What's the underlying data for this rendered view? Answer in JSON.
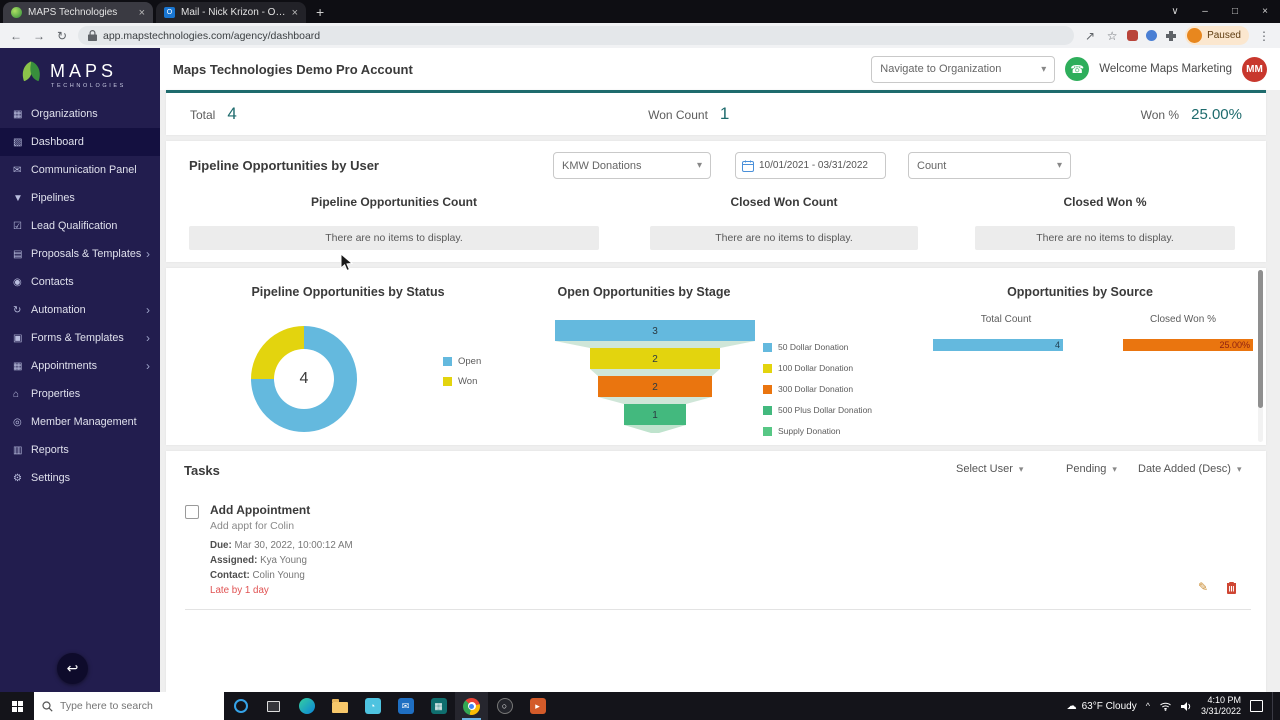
{
  "colors": {
    "accent_teal": "#1e6b6d",
    "sidebar_bg": "#221d4e",
    "sidebar_active": "#141040",
    "chart_blue": "#64b9de",
    "chart_yellow": "#e3d40e",
    "chart_orange": "#ea750f",
    "chart_green": "#43b97e",
    "chart_green_light": "#57c785",
    "late_red": "#e05252",
    "avatar_red": "#c8372d",
    "phone_green": "#2eae5b"
  },
  "browser": {
    "tabs": [
      {
        "title": "MAPS Technologies"
      },
      {
        "title": "Mail - Nick Krizon - Outlook"
      }
    ],
    "url": "app.mapstechnologies.com/agency/dashboard",
    "profile_badge": "Paused"
  },
  "icons": {
    "back": "←",
    "forward": "→",
    "refresh": "↻",
    "star": "☆",
    "kebab": "⋮",
    "new_tab": "+",
    "tab_close": "×",
    "caret": "∨",
    "minimize": "–",
    "maximize": "□",
    "close": "×",
    "chevron_down": "▾",
    "chevron_right": "›",
    "tray_up": "^",
    "phone": "☎",
    "pencil": "✎",
    "back_fab": "↩",
    "cloud": "☁",
    "outlook": "O"
  },
  "sidebar": {
    "logo_title": "MAPS",
    "logo_subtitle": "TECHNOLOGIES",
    "items": [
      {
        "label": "Organizations",
        "icon": "▦"
      },
      {
        "label": "Dashboard",
        "icon": "▧"
      },
      {
        "label": "Communication Panel",
        "icon": "✉"
      },
      {
        "label": "Pipelines",
        "icon": "▼"
      },
      {
        "label": "Lead Qualification",
        "icon": "☑"
      },
      {
        "label": "Proposals & Templates",
        "icon": "▤"
      },
      {
        "label": "Contacts",
        "icon": "◉"
      },
      {
        "label": "Automation",
        "icon": "↻"
      },
      {
        "label": "Forms & Templates",
        "icon": "▣"
      },
      {
        "label": "Appointments",
        "icon": "▦"
      },
      {
        "label": "Properties",
        "icon": "⌂"
      },
      {
        "label": "Member Management",
        "icon": "◎"
      },
      {
        "label": "Reports",
        "icon": "▥"
      },
      {
        "label": "Settings",
        "icon": "⚙"
      }
    ]
  },
  "header": {
    "title": "Maps Technologies Demo Pro Account",
    "org_dropdown": "Navigate to Organization",
    "welcome": "Welcome Maps Marketing",
    "avatar_initials": "MM"
  },
  "stats": {
    "total_label": "Total",
    "total_value": "4",
    "won_count_label": "Won Count",
    "won_count_value": "1",
    "won_pct_label": "Won %",
    "won_pct_value": "25.00%"
  },
  "pipeline": {
    "title": "Pipeline Opportunities by User",
    "pipeline_select": "KMW Donations",
    "date_range": "10/01/2021 - 03/31/2022",
    "metric_select": "Count",
    "columns": [
      {
        "header": "Pipeline Opportunities Count",
        "empty": "There are no items to display."
      },
      {
        "header": "Closed Won Count",
        "empty": "There are no items to display."
      },
      {
        "header": "Closed Won %",
        "empty": "There are no items to display."
      }
    ]
  },
  "chart_data": [
    {
      "type": "pie",
      "title": "Pipeline Opportunities by Status",
      "center_total": "4",
      "legend_position": "right",
      "slices": [
        {
          "label": "Open",
          "value": 3,
          "color": "#64b9de"
        },
        {
          "label": "Won",
          "value": 1,
          "color": "#e3d40e"
        }
      ]
    },
    {
      "type": "funnel",
      "title": "Open Opportunities by Stage",
      "legend_position": "right",
      "stages": [
        {
          "label": "50 Dollar Donation",
          "value": 3,
          "color": "#64b9de"
        },
        {
          "label": "100 Dollar Donation",
          "value": 2,
          "color": "#e3d40e"
        },
        {
          "label": "300 Dollar Donation",
          "value": 2,
          "color": "#ea750f"
        },
        {
          "label": "500 Plus Dollar Donation",
          "value": 1,
          "color": "#43b97e"
        },
        {
          "label": "Supply Donation",
          "value": 0,
          "color": "#57c785"
        }
      ]
    },
    {
      "type": "bar",
      "title": "Opportunities by Source",
      "orientation": "horizontal",
      "bars": [
        {
          "label": "Total Count",
          "value": 4,
          "display": "4",
          "color": "#64b9de"
        },
        {
          "label": "Closed Won %",
          "value": 25.0,
          "display": "25.00%",
          "color": "#ea750f"
        }
      ]
    }
  ],
  "tasks": {
    "title": "Tasks",
    "filter_user": "Select User",
    "filter_status": "Pending",
    "filter_sort": "Date Added (Desc)",
    "items": [
      {
        "title": "Add Appointment",
        "subtitle": "Add appt for Colin",
        "due_label": "Due:",
        "due": "Mar 30, 2022, 10:00:12 AM",
        "assigned_label": "Assigned:",
        "assigned": "Kya Young",
        "contact_label": "Contact:",
        "contact": "Colin Young",
        "status": "Late by 1 day"
      }
    ]
  },
  "taskbar": {
    "search_placeholder": "Type here to search",
    "weather": "63°F Cloudy",
    "time": "4:10 PM",
    "date": "3/31/2022"
  }
}
